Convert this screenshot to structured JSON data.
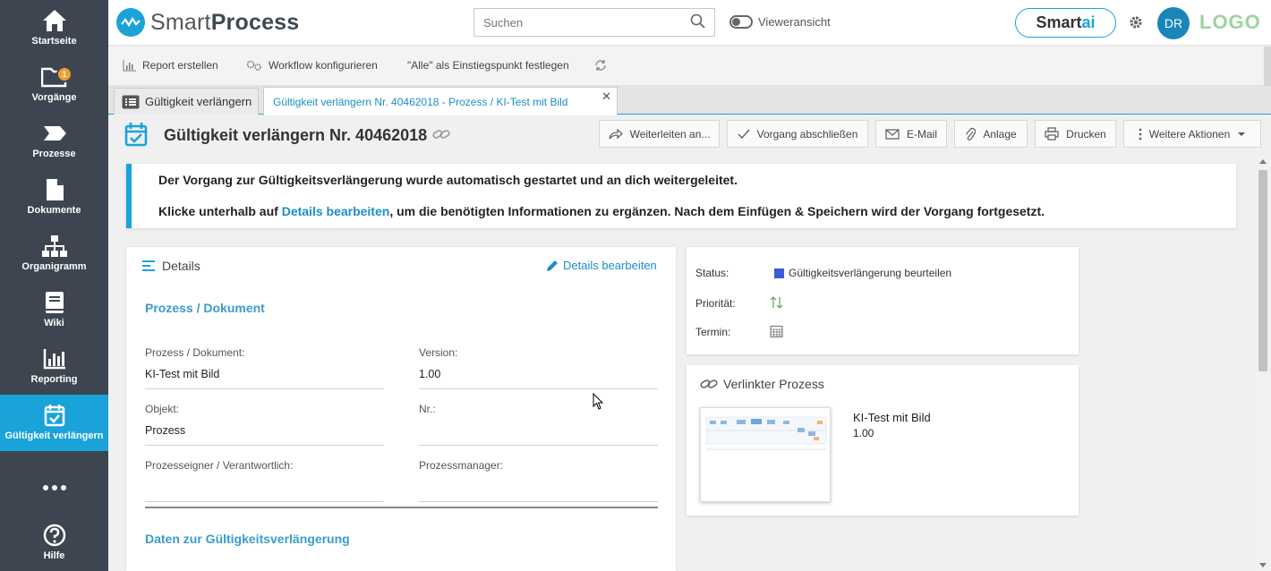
{
  "sidebar": {
    "items": [
      {
        "label": "Startseite",
        "icon": "home-icon"
      },
      {
        "label": "Vorgänge",
        "icon": "folder-icon",
        "badge": "1"
      },
      {
        "label": "Prozesse",
        "icon": "process-icon"
      },
      {
        "label": "Dokumente",
        "icon": "document-icon"
      },
      {
        "label": "Organigramm",
        "icon": "org-chart-icon"
      },
      {
        "label": "Wiki",
        "icon": "book-icon"
      },
      {
        "label": "Reporting",
        "icon": "bar-chart-icon"
      },
      {
        "label": "Gültigkeit verlängern",
        "icon": "calendar-check-icon",
        "active": true
      },
      {
        "label": "",
        "icon": "more-icon"
      },
      {
        "label": "Hilfe",
        "icon": "help-icon"
      }
    ]
  },
  "topbar": {
    "brand_light": "Smart",
    "brand_bold": "Process",
    "search_placeholder": "Suchen",
    "viewer_label": "Vieweransicht",
    "smartai_a": "Smart",
    "smartai_b": "ai",
    "avatar": "DR",
    "logo": "LOGO"
  },
  "toolbar": {
    "report": "Report erstellen",
    "workflow": "Workflow konfigurieren",
    "entry_point": "\"Alle\" als Einstiegspunkt festlegen"
  },
  "tabs": {
    "tab1": "Gültigkeit verlängern",
    "tab2": "Gültigkeit verlängern Nr. 40462018 - Prozess / KI-Test mit Bild",
    "close": "✕"
  },
  "page": {
    "title": "Gültigkeit verlängern Nr. 40462018",
    "actions": {
      "forward": "Weiterleiten an...",
      "close": "Vorgang abschließen",
      "email": "E-Mail",
      "attachment": "Anlage",
      "print": "Drucken",
      "more": "Weitere Aktionen"
    }
  },
  "banner": {
    "line1": "Der Vorgang zur Gültigkeitsverlängerung wurde automatisch gestartet und an dich weitergeleitet.",
    "line2_pre": "Klicke unterhalb auf ",
    "line2_link": "Details bearbeiten",
    "line2_post": ", um die benötigten Informationen zu ergänzen. Nach dem Einfügen & Speichern wird der Vorgang fortgesetzt."
  },
  "details": {
    "heading": "Details",
    "edit": "Details bearbeiten",
    "section1": "Prozess / Dokument",
    "fields": {
      "process_label": "Prozess / Dokument:",
      "process_value": "KI-Test mit Bild",
      "version_label": "Version:",
      "version_value": "1.00",
      "object_label": "Objekt:",
      "object_value": "Prozess",
      "nr_label": "Nr.:",
      "nr_value": "",
      "owner_label": "Prozesseigner / Verantwortlich:",
      "owner_value": "",
      "manager_label": "Prozessmanager:",
      "manager_value": ""
    },
    "section2": "Daten zur Gültigkeitsverlängerung"
  },
  "status": {
    "status_label": "Status:",
    "status_value": "Gültigkeitsverlängerung beurteilen",
    "status_color": "#3b5bdb",
    "priority_label": "Priorität:",
    "date_label": "Termin:"
  },
  "linked": {
    "heading": "Verlinkter Prozess",
    "name": "KI-Test mit Bild",
    "version": "1.00"
  }
}
